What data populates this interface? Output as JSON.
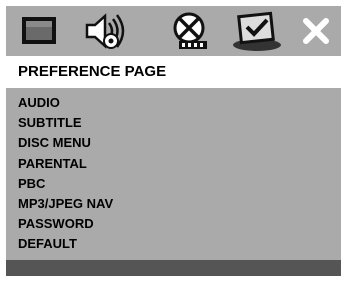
{
  "icons": [
    "general-setup-page-icon",
    "audio-setup-page-icon",
    "video-setup-page-icon",
    "preference-page-icon",
    "exit-icon"
  ],
  "header": {
    "title": "PREFERENCE PAGE"
  },
  "menu": {
    "items": [
      "AUDIO",
      "SUBTITLE",
      "DISC MENU",
      "PARENTAL",
      "PBC",
      "MP3/JPEG NAV",
      "PASSWORD",
      "DEFAULT"
    ]
  },
  "colors": {
    "panel": "#aaaaaa",
    "header_bg": "#ffffff",
    "footer": "#555555",
    "text": "#000000"
  }
}
